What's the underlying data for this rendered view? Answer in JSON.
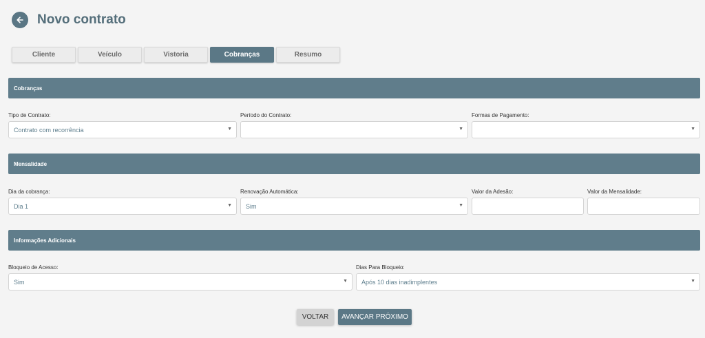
{
  "header": {
    "title": "Novo contrato"
  },
  "tabs": [
    {
      "label": "Cliente"
    },
    {
      "label": "Veículo"
    },
    {
      "label": "Vistoria"
    },
    {
      "label": "Cobranças"
    },
    {
      "label": "Resumo"
    }
  ],
  "sections": {
    "cobrancas": "Cobranças",
    "mensalidade": "Mensalidade",
    "info": "Informações Adicionais"
  },
  "fields": {
    "tipo_contrato": {
      "label": "Tipo de Contrato:",
      "value": "Contrato com recorrência"
    },
    "periodo_contrato": {
      "label": "Período do Contrato:",
      "value": ""
    },
    "formas_pagamento": {
      "label": "Formas de Pagamento:",
      "value": ""
    },
    "dia_cobranca": {
      "label": "Dia da cobrança:",
      "value": "Dia 1"
    },
    "renovacao": {
      "label": "Renovação Automática:",
      "value": "Sim"
    },
    "valor_adesao": {
      "label": "Valor da Adesão:",
      "value": ""
    },
    "valor_mensalidade": {
      "label": "Valor da Mensalidade:",
      "value": ""
    },
    "bloqueio_acesso": {
      "label": "Bloqueio de Acesso:",
      "value": "Sim"
    },
    "dias_bloqueio": {
      "label": "Dias Para Bloqueio:",
      "value": "Após 10 dias inadimplentes"
    }
  },
  "buttons": {
    "voltar": "VOLTAR",
    "avancar": "AVANÇAR PRÓXIMO"
  },
  "icons": {
    "back": "arrow-left-icon",
    "dropdown": "caret-down-icon"
  },
  "colors": {
    "accent": "#607d8b",
    "background": "#f4f4f4"
  }
}
